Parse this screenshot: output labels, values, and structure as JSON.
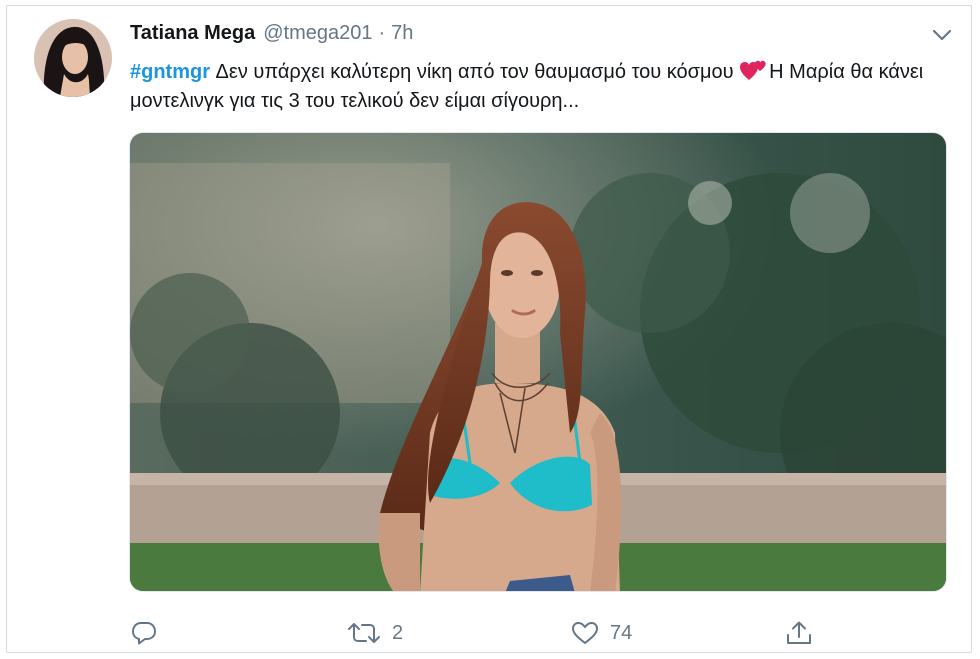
{
  "tweet": {
    "display_name": "Tatiana Mega",
    "handle": "@tmega201",
    "separator": "·",
    "time": "7h",
    "hashtag": "#gntmgr",
    "text_part1": " Δεν υπάρχει καλύτερη νίκη από τον θαυμασμό του κόσμου ",
    "text_part2": "Η Μαρία θα κάνει μοντελινγκ για τις 3 του τελικού δεν είμαι σίγουρη...",
    "emoji": "two-hearts-emoji"
  },
  "actions": {
    "reply": {
      "icon": "reply-icon",
      "count": ""
    },
    "retweet": {
      "icon": "retweet-icon",
      "count": "2"
    },
    "like": {
      "icon": "heart-icon",
      "count": "74"
    },
    "share": {
      "icon": "share-icon",
      "count": ""
    }
  },
  "colors": {
    "link": "#1b95e0",
    "text": "#14171a",
    "secondary": "#657786",
    "border": "#d4dbe1"
  }
}
